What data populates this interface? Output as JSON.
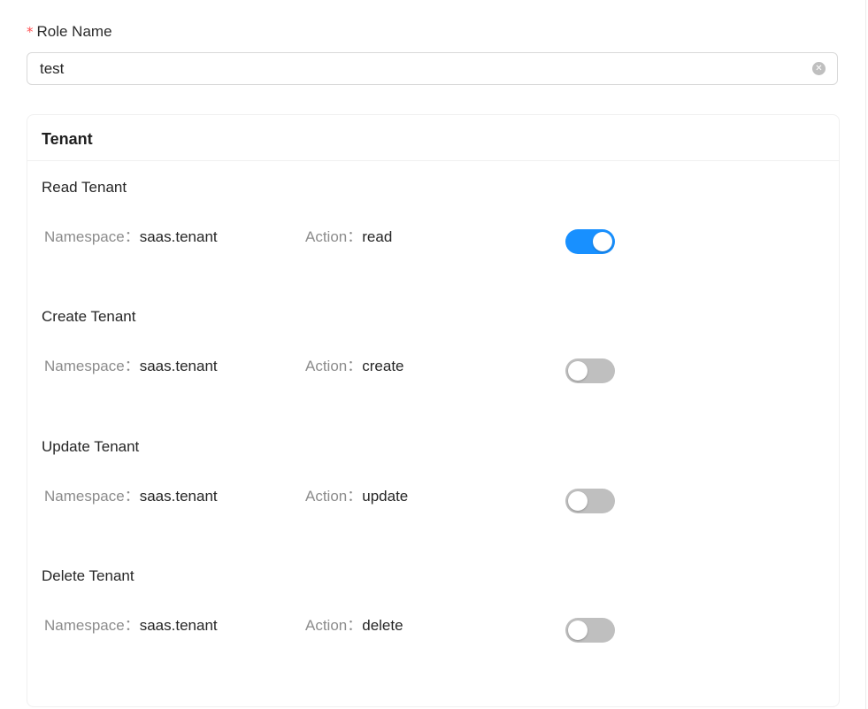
{
  "form": {
    "required_mark": "*",
    "role_name_label": "Role Name",
    "role_name_value": "test",
    "clear_icon": "close-circle-icon"
  },
  "card": {
    "title": "Tenant",
    "permissions": [
      {
        "title": "Read Tenant",
        "namespace_label": "Namespace：",
        "namespace": "saas.tenant",
        "action_label": "Action：",
        "action": "read",
        "enabled": true
      },
      {
        "title": "Create Tenant",
        "namespace_label": "Namespace：",
        "namespace": "saas.tenant",
        "action_label": "Action：",
        "action": "create",
        "enabled": false
      },
      {
        "title": "Update Tenant",
        "namespace_label": "Namespace：",
        "namespace": "saas.tenant",
        "action_label": "Action：",
        "action": "update",
        "enabled": false
      },
      {
        "title": "Delete Tenant",
        "namespace_label": "Namespace：",
        "namespace": "saas.tenant",
        "action_label": "Action：",
        "action": "delete",
        "enabled": false
      }
    ]
  },
  "colors": {
    "switch_on": "#1890ff",
    "switch_off": "#bfbfbf",
    "required": "#ff4d4f"
  }
}
